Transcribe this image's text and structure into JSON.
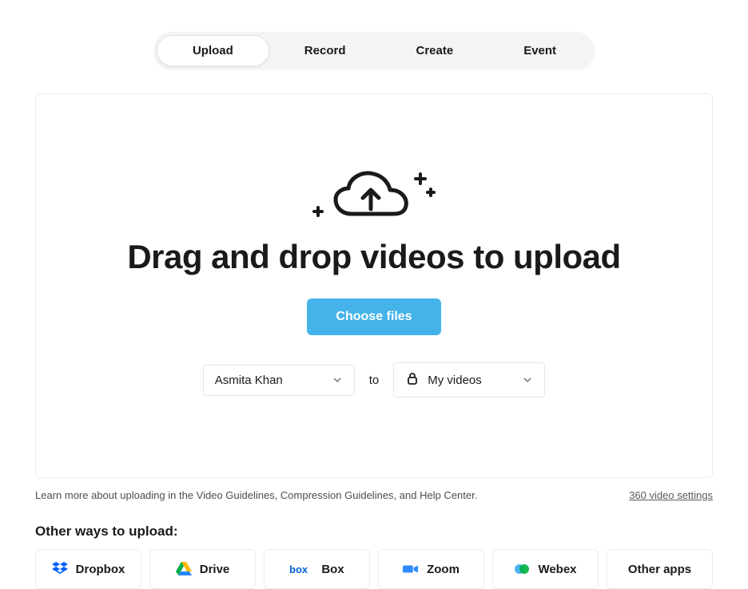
{
  "tabs": {
    "items": [
      {
        "label": "Upload",
        "active": true
      },
      {
        "label": "Record",
        "active": false
      },
      {
        "label": "Create",
        "active": false
      },
      {
        "label": "Event",
        "active": false
      }
    ]
  },
  "upload": {
    "heading": "Drag and drop videos to upload",
    "choose_button": "Choose files",
    "uploader_select": "Asmita Khan",
    "to_label": "to",
    "privacy_select": "My videos"
  },
  "footer": {
    "learn_text": "Learn more about uploading in the Video Guidelines, Compression Guidelines, and Help Center.",
    "settings_link": "360 video settings"
  },
  "other_ways": {
    "heading": "Other ways to upload:",
    "apps": [
      {
        "name": "Dropbox"
      },
      {
        "name": "Drive"
      },
      {
        "name": "Box"
      },
      {
        "name": "Zoom"
      },
      {
        "name": "Webex"
      },
      {
        "name": "Other apps"
      }
    ]
  }
}
